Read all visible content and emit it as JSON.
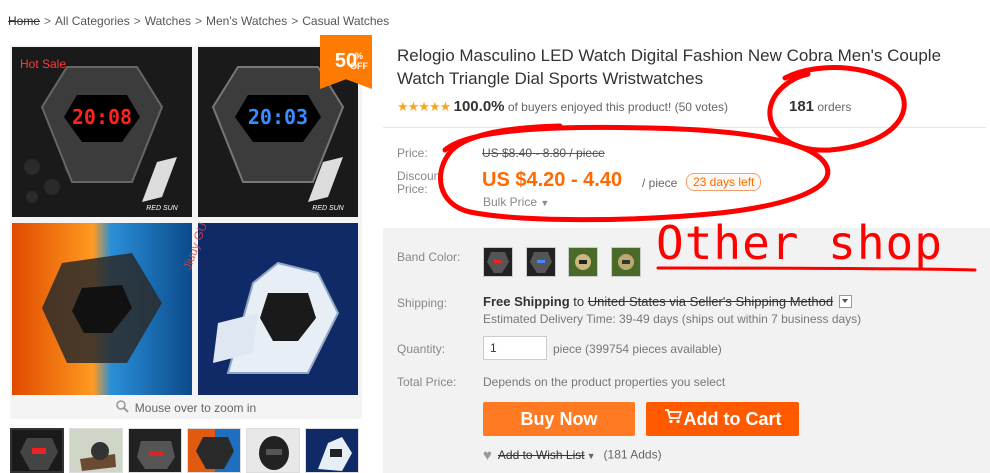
{
  "breadcrumb": {
    "home": "Home",
    "sep": ">",
    "items": [
      "All Categories",
      "Watches",
      "Men's Watches",
      "Casual Watches"
    ]
  },
  "gallery": {
    "hot_sale": "Hot Sale",
    "discount_badge": "50",
    "discount_badge_sup": "%",
    "discount_badge_off": "OFF",
    "brand_mark": "RED SUN",
    "watch_display_red": "20:08",
    "watch_display_blue": "20:03",
    "watermark": "Jiuuy GU",
    "zoom_hint": "Mouse over to zoom in",
    "thumbnails": [
      "thumb-1",
      "thumb-2",
      "thumb-3",
      "thumb-4",
      "thumb-5",
      "thumb-6"
    ]
  },
  "product": {
    "title": "Relogio Masculino LED Watch Digital Fashion New Cobra Men's Couple Watch Triangle Dial Sports Wristwatches",
    "stars": "★★★★★",
    "rating_percent": "100.0%",
    "rating_text": "of buyers enjoyed this product! (50 votes)",
    "orders_count": "181",
    "orders_label": "orders"
  },
  "price": {
    "price_label": "Price:",
    "old_price": "US $8.40 - 8.80 / piece",
    "discount_label_1": "Discount",
    "discount_label_2": "Price:",
    "current_price": "US $4.20 - 4.40",
    "unit": "/ piece",
    "days_left": "23 days left",
    "bulk_price": "Bulk Price"
  },
  "options": {
    "band_color_label": "Band Color:",
    "shipping_label": "Shipping:",
    "free_shipping": "Free Shipping",
    "to": "to",
    "ship_method": "United States via Seller's Shipping Method",
    "estimated": "Estimated Delivery Time: 39-49 days (ships out within 7 business days)",
    "quantity_label": "Quantity:",
    "quantity_value": "1",
    "quantity_note": "piece (399754 pieces available)",
    "total_label": "Total Price:",
    "total_value": "Depends on the product properties you select"
  },
  "actions": {
    "buy_now": "Buy Now",
    "add_to_cart": "Add to Cart",
    "wish_list": "Add to Wish List",
    "wish_adds": "(181 Adds)"
  },
  "annotation": {
    "other_shop": "Other shop",
    "color": "#ff0000"
  },
  "colors": {
    "accent": "#ff6a00",
    "buy_button": "#ff7a22",
    "cart_button": "#ff5a00",
    "panel_bg": "#f2f2f2"
  }
}
